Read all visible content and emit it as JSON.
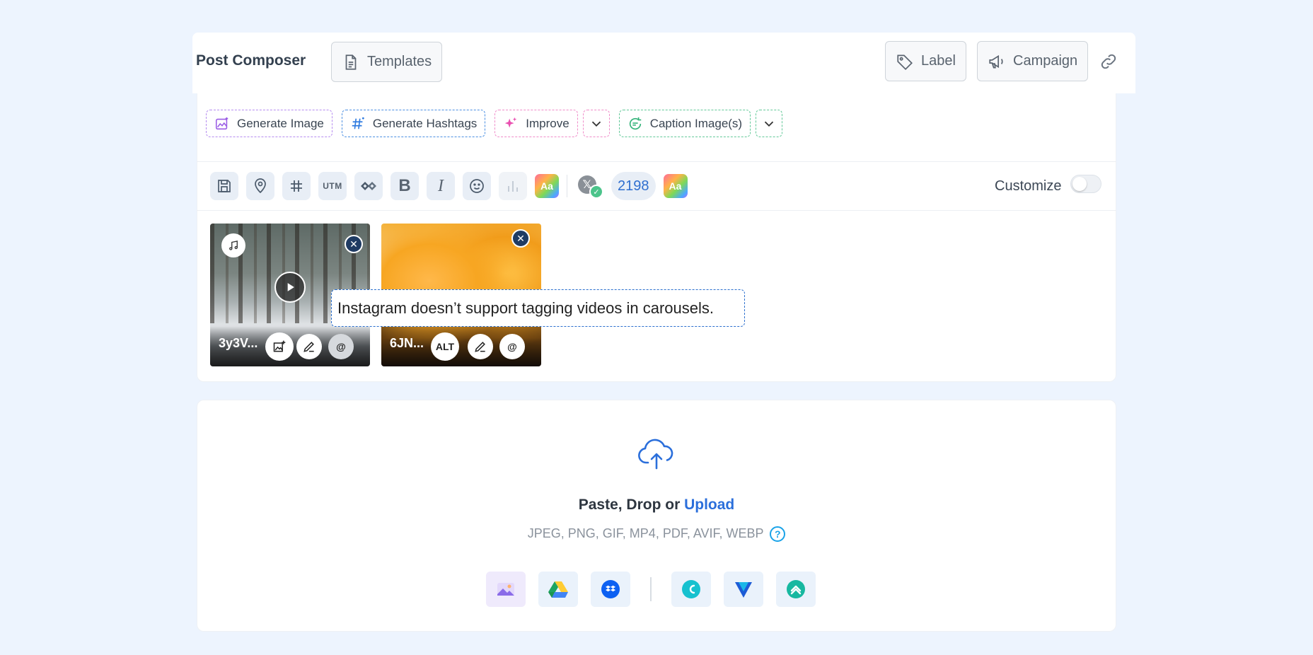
{
  "header": {
    "title": "Post Composer",
    "templates_label": "Templates",
    "label_label": "Label",
    "campaign_label": "Campaign"
  },
  "ai_actions": {
    "generate_image": "Generate Image",
    "generate_hashtags": "Generate Hashtags",
    "improve": "Improve",
    "caption_images": "Caption Image(s)"
  },
  "toolbar": {
    "utm": "UTM",
    "bold": "B",
    "italic": "I",
    "aa": "Aa",
    "x_letter": "𝕏",
    "char_count": "2198",
    "customize_label": "Customize",
    "customize_on": false
  },
  "media": [
    {
      "filename": "3y3V...",
      "type": "video"
    },
    {
      "filename": "6JN...",
      "type": "image",
      "alt_label": "ALT"
    }
  ],
  "tooltip": "Instagram doesn’t support tagging videos in carousels.",
  "upload": {
    "prefix": "Paste, Drop or ",
    "link": "Upload",
    "formats": "JPEG, PNG, GIF, MP4, PDF, AVIF, WEBP",
    "help": "?"
  },
  "sources": [
    "media-library-icon",
    "google-drive-icon",
    "dropbox-icon",
    "canva-icon",
    "vista-create-icon",
    "adobe-express-icon"
  ],
  "colors": {
    "accent": "#2b6fdb",
    "background": "#edf4fe"
  }
}
